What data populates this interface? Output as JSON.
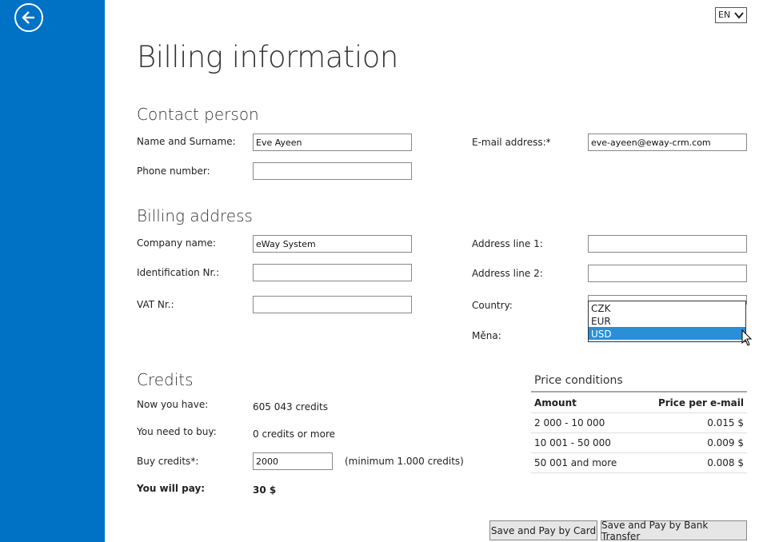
{
  "language": "EN",
  "page_title": "Billing information",
  "contact": {
    "section_title": "Contact person",
    "name_label": "Name and Surname:",
    "name_value": "Eve Ayeen",
    "phone_label": "Phone number:",
    "phone_value": "",
    "email_label": "E-mail address:*",
    "email_value": "eve-ayeen@eway-crm.com"
  },
  "billing": {
    "section_title": "Billing address",
    "company_label": "Company name:",
    "company_value": "eWay System",
    "id_label": "Identification Nr.:",
    "id_value": "",
    "vat_label": "VAT Nr.:",
    "vat_value": "",
    "address1_label": "Address line 1:",
    "address1_value": "",
    "address2_label": "Address line 2:",
    "address2_value": "",
    "country_label": "Country:",
    "currency_label": "Měna:",
    "currency_options": [
      "CZK",
      "EUR",
      "USD"
    ],
    "currency_selected": "USD"
  },
  "credits": {
    "section_title": "Credits",
    "have_label": "Now you have:",
    "have_value": "605 043 credits",
    "need_label": "You need to buy:",
    "need_value": "0 credits or more",
    "buy_label": "Buy credits*:",
    "buy_value": "2000",
    "buy_hint": "(minimum 1.000 credits)",
    "pay_label": "You will pay:",
    "pay_value": "30 $"
  },
  "price_conditions": {
    "title": "Price conditions",
    "col_amount": "Amount",
    "col_price": "Price per e-mail",
    "rows": [
      {
        "amount": "2 000 - 10 000",
        "price": "0.015 $"
      },
      {
        "amount": "10 001 - 50 000",
        "price": "0.009 $"
      },
      {
        "amount": "50 001 and more",
        "price": "0.008 $"
      }
    ]
  },
  "buttons": {
    "pay_card": "Save and Pay by Card",
    "pay_bank": "Save and Pay by Bank Transfer"
  },
  "colors": {
    "sidebar": "#0072c6",
    "selection": "#2a8fd6"
  }
}
